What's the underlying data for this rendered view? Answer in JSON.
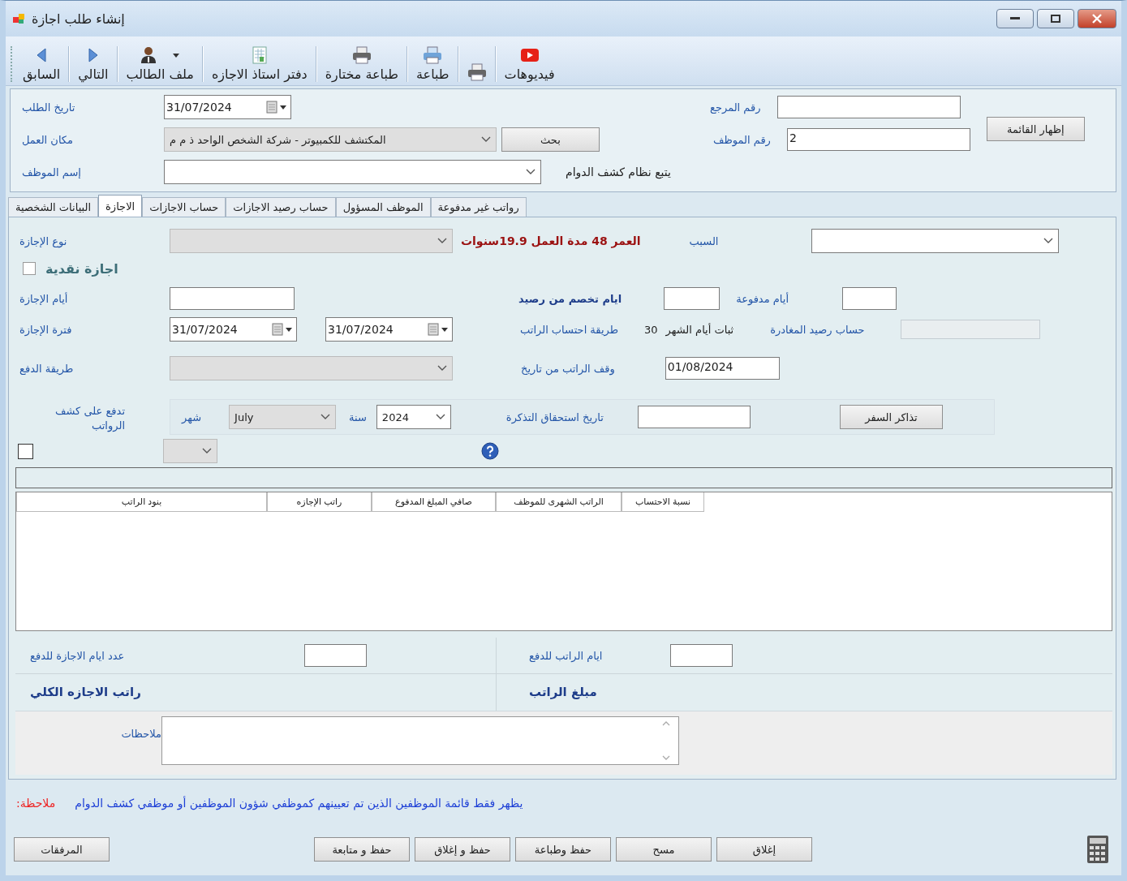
{
  "window": {
    "title": "إنشاء طلب اجازة"
  },
  "toolbar": [
    {
      "kind": "labeled",
      "label": "فيديوهات",
      "dropdown": false
    },
    {
      "kind": "icon_only",
      "dropdown": false
    },
    {
      "kind": "labeled",
      "label": "طباعة",
      "dropdown": false
    },
    {
      "kind": "labeled",
      "label": "طباعة مختارة",
      "dropdown": false
    },
    {
      "kind": "labeled",
      "label": "دفتر استاذ الاجازه",
      "dropdown": false
    },
    {
      "kind": "labeled",
      "label": "ملف الطالب",
      "dropdown": true
    },
    {
      "kind": "labeled",
      "label": "التالي",
      "dropdown": false
    },
    {
      "kind": "labeled",
      "label": "السابق",
      "dropdown": false
    }
  ],
  "header": {
    "request_date": {
      "label": "تاريخ الطلب",
      "value": "31/07/2024"
    },
    "reference_no": {
      "label": "رقم المرجع"
    },
    "show_list_button": "إظهار القائمة",
    "workplace": {
      "label": "مكان العمل",
      "value": "المكتشف للكمبيوتر - شركة الشخص الواحد ذ م م"
    },
    "search_button": "بحث",
    "employee_no": {
      "label": "رقم الموظف",
      "value": "2"
    },
    "employee_name": {
      "label": "إسم الموظف"
    },
    "attendance_note": "يتبع نظام كشف الدوام"
  },
  "tabs": [
    {
      "label": "رواتب غير مدفوعة",
      "selected": false
    },
    {
      "label": "الموظف المسؤول",
      "selected": false
    },
    {
      "label": "حساب رصيد الاجازات",
      "selected": false
    },
    {
      "label": "حساب الاجازات",
      "selected": false
    },
    {
      "label": "الاجازة",
      "selected": true
    },
    {
      "label": "البيانات الشخصية",
      "selected": false
    }
  ],
  "leave": {
    "leave_type": {
      "label": "نوع الإجازة",
      "disabled": true
    },
    "age_info": "العمر 48 مدة العمل 19.9سنوات",
    "reason": {
      "label": "السبب",
      "disabled": false
    },
    "cash_leave": {
      "label": "اجازة نقدية",
      "checked": false
    },
    "leave_days": {
      "label": "أيام الإجازة"
    },
    "deducted_days": {
      "label": "ايام تخصم من رصيد"
    },
    "paid_days": {
      "label": "أيام مدفوعة"
    },
    "leave_period": {
      "label": "فترة الإجازة",
      "from": "31/07/2024",
      "to": "31/07/2024"
    },
    "salary_method": {
      "label": "طريقة احتساب الراتب",
      "value": "ثبات أيام الشهر",
      "days": "30"
    },
    "departure_balance": {
      "label": "حساب رصيد المغادرة",
      "disabled": true
    },
    "payment_method": {
      "label": "طريقة الدفع",
      "disabled": true
    },
    "salary_stop": {
      "label": "وقف الراتب من تاريخ",
      "value": "01/08/2024"
    },
    "payroll": {
      "label": "تدفع على كشف الرواتب",
      "checked": false,
      "month_label": "شهر",
      "month": "July",
      "year_label": "سنة",
      "year": "2024"
    },
    "ticket_due": {
      "label": "تاريخ استحقاق التذكرة"
    },
    "tickets_button": "تذاكر السفر"
  },
  "grid": {
    "columns": [
      "نسبة الاحتساب",
      "الراتب الشهرى للموظف",
      "صافي المبلغ المدفوع",
      "راتب الإجازه",
      "بنود الراتب"
    ]
  },
  "summary": {
    "leave_days_to_pay": "عدد ايام الاجازة للدفع",
    "salary_days_to_pay": "ايام الراتب للدفع",
    "total_leave_salary": "راتب الاجازه الكلي",
    "salary_amount": "مبلغ الراتب",
    "notes_label": "ملاحظات"
  },
  "footer_note": {
    "label": "ملاحظة:",
    "text": "يظهر فقط قائمة الموظفين الذين تم تعيينهم كموظفي شؤون الموظفين أو موظفي كشف الدوام"
  },
  "buttons": [
    "إغلاق",
    "مسح",
    "حفظ وطباعة",
    "حفظ و إغلاق",
    "حفظ و متابعة"
  ],
  "attachments_button": "المرفقات"
}
